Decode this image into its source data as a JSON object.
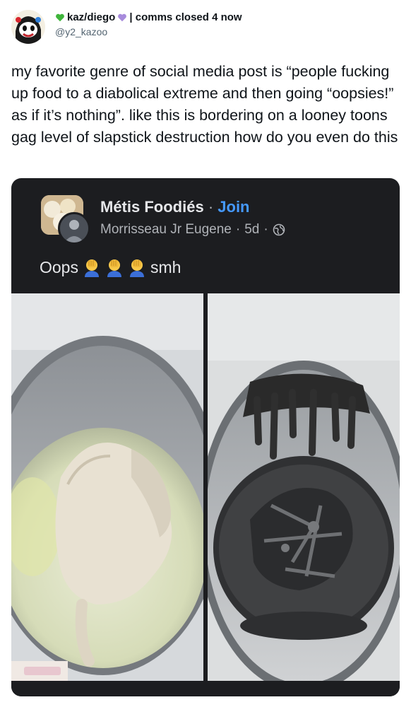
{
  "tweet": {
    "display_name": "kaz/diego",
    "bio_fragment": "| comms closed 4 now",
    "handle": "@y2_kazoo",
    "text": "my favorite genre of social media post is “people fucking up food to a diabolical extreme and then going “oopsies!” as if it’s nothing”. like this is bordering on a looney toons gag level of slapstick destruction how do you even do this",
    "heart_colors": {
      "green": "#3fb53b",
      "purple": "#a78bdc"
    }
  },
  "embedded_post": {
    "group_name": "Métis Foodiés",
    "separator": "·",
    "join_label": "Join",
    "author": "Morrisseau Jr Eugene",
    "age": "5d",
    "privacy_icon": "globe-icon",
    "caption_start": "Oops",
    "caption_end": "smh",
    "caption_emoji": [
      "facepalm-icon",
      "facepalm-icon",
      "facepalm-icon"
    ],
    "photos": [
      {
        "name": "raw-chicken-in-pot"
      },
      {
        "name": "burnt-chicken-in-pot"
      }
    ]
  }
}
